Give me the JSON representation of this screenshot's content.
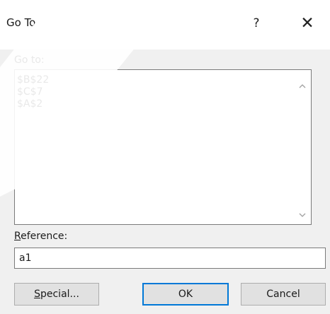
{
  "window": {
    "title": "Go To",
    "help_glyph": "?",
    "close_glyph": "✕"
  },
  "goto": {
    "label": "Go to:",
    "items": [
      "$B$22",
      "$C$7",
      "$A$2"
    ]
  },
  "reference": {
    "label_mnemonic": "R",
    "label_rest": "eference:",
    "value": "a1"
  },
  "buttons": {
    "special_mnemonic": "S",
    "special_rest": "pecial...",
    "ok_label": "OK",
    "cancel_label": "Cancel"
  },
  "icons": {
    "scroll_up": "chevron-up-icon",
    "scroll_down": "chevron-down-icon"
  }
}
